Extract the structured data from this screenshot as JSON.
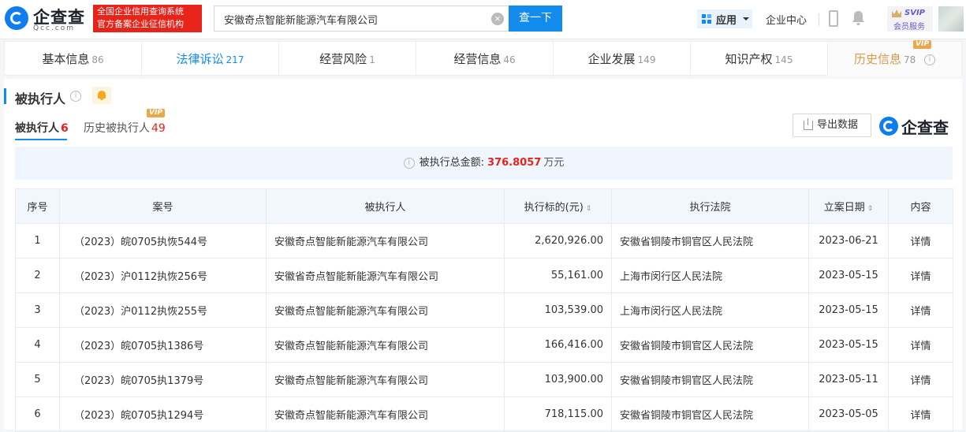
{
  "header": {
    "logo_text": "企查查",
    "logo_sub": "Qcc.com",
    "badge_line1": "全国企业信用查询系统",
    "badge_line2": "官方备案企业征信机构",
    "search_value": "安徽奇点智能新能源汽车有限公司",
    "search_button": "查一下",
    "app_label": "应用",
    "enterprise_center": "企业中心",
    "svip_title": "SVIP",
    "svip_sub": "会员服务"
  },
  "tabs": [
    {
      "label": "基本信息",
      "count": "86"
    },
    {
      "label": "法律诉讼",
      "count": "217"
    },
    {
      "label": "经营风险",
      "count": "1"
    },
    {
      "label": "经营信息",
      "count": "46"
    },
    {
      "label": "企业发展",
      "count": "149"
    },
    {
      "label": "知识产权",
      "count": "145"
    },
    {
      "label": "历史信息",
      "count": "78",
      "vip": "VIP"
    }
  ],
  "section": {
    "title": "被执行人",
    "subtab1_label": "被执行人",
    "subtab1_count": "6",
    "subtab2_label": "历史被执行人",
    "subtab2_count": "49",
    "subtab2_vip": "VIP",
    "export_label": "导出数据",
    "brand_text": "企查查",
    "summary_label": "被执行总金额:",
    "summary_amount": "376.8057",
    "summary_unit": "万元"
  },
  "table": {
    "headers": {
      "idx": "序号",
      "case": "案号",
      "party": "被执行人",
      "amount": "执行标的(元)",
      "court": "执行法院",
      "date": "立案日期",
      "content": "内容"
    },
    "rows": [
      {
        "idx": "1",
        "case": "（2023）皖0705执恢544号",
        "party": "安徽奇点智能新能源汽车有限公司",
        "amount": "2,620,926.00",
        "court": "安徽省铜陵市铜官区人民法院",
        "date": "2023-06-21",
        "detail": "详情"
      },
      {
        "idx": "2",
        "case": "（2023）沪0112执恢256号",
        "party": "安徽省奇点智能新能源汽车有限公司",
        "amount": "55,161.00",
        "court": "上海市闵行区人民法院",
        "date": "2023-05-15",
        "detail": "详情"
      },
      {
        "idx": "3",
        "case": "（2023）沪0112执恢255号",
        "party": "安徽奇点智能新能源汽车有限公司",
        "amount": "103,539.00",
        "court": "上海市闵行区人民法院",
        "date": "2023-05-15",
        "detail": "详情"
      },
      {
        "idx": "4",
        "case": "（2023）皖0705执1386号",
        "party": "安徽奇点智能新能源汽车有限公司",
        "amount": "166,416.00",
        "court": "安徽省铜陵市铜官区人民法院",
        "date": "2023-05-15",
        "detail": "详情"
      },
      {
        "idx": "5",
        "case": "（2023）皖0705执1379号",
        "party": "安徽奇点智能新能源汽车有限公司",
        "amount": "103,900.00",
        "court": "安徽省铜陵市铜官区人民法院",
        "date": "2023-05-11",
        "detail": "详情"
      },
      {
        "idx": "6",
        "case": "（2023）皖0705执1294号",
        "party": "安徽奇点智能新能源汽车有限公司",
        "amount": "718,115.00",
        "court": "安徽省铜陵市铜官区人民法院",
        "date": "2023-05-05",
        "detail": "详情"
      }
    ]
  }
}
